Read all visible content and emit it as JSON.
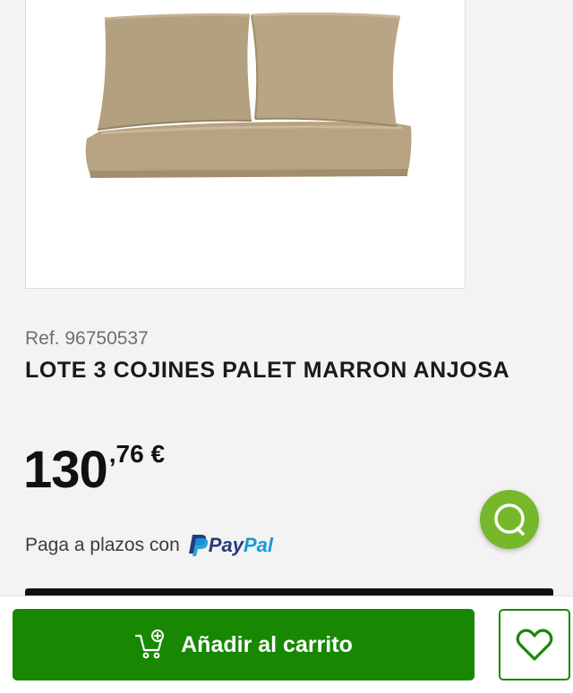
{
  "product": {
    "ref": "Ref. 96750537",
    "title": "LOTE 3 COJINES PALET MARRON ANJOSA",
    "image_icon": "cushion-set-image",
    "price": {
      "integer": "130",
      "decimal": ",76 €"
    },
    "installments": {
      "text": "Paga a plazos con",
      "provider_pay": "Pay",
      "provider_pal": "Pal"
    }
  },
  "actions": {
    "add_to_cart_label": "Añadir al carrito",
    "cart_icon": "add-to-cart-icon",
    "wishlist_icon": "heart-icon",
    "chat_icon": "chat-bubble-icon"
  },
  "colors": {
    "primary_green": "#188803",
    "chat_green": "#76b82a",
    "paypal_dark": "#253b80",
    "paypal_light": "#179bd7",
    "cushion": "#b8a383"
  }
}
